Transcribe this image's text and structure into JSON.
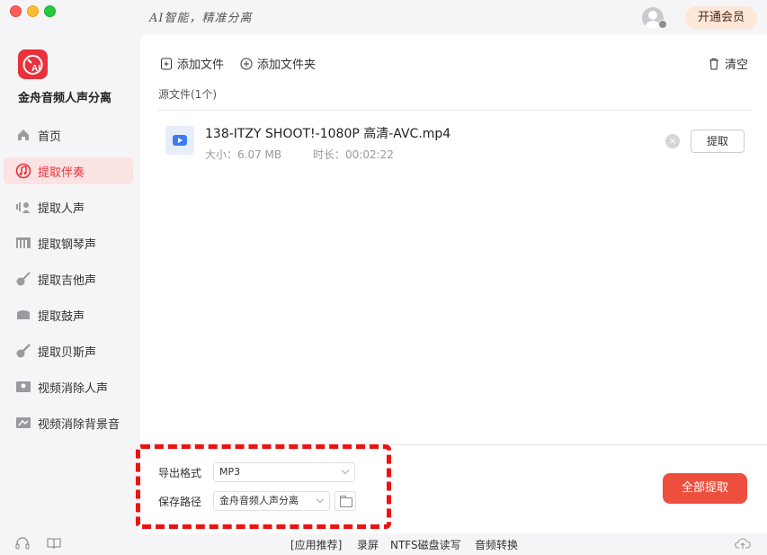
{
  "titlebar": {
    "slogan": "AI智能，精准分离",
    "vip_button": "开通会员"
  },
  "sidebar": {
    "app_name": "金舟音频人声分离",
    "logo_text": "AI",
    "items": [
      {
        "label": "首页",
        "icon": "home-icon"
      },
      {
        "label": "提取伴奏",
        "icon": "accompaniment-icon",
        "active": true
      },
      {
        "label": "提取人声",
        "icon": "voice-icon"
      },
      {
        "label": "提取钢琴声",
        "icon": "piano-icon"
      },
      {
        "label": "提取吉他声",
        "icon": "guitar-icon"
      },
      {
        "label": "提取鼓声",
        "icon": "drum-icon"
      },
      {
        "label": "提取贝斯声",
        "icon": "bass-icon"
      },
      {
        "label": "视频消除人声",
        "icon": "video-remove-voice-icon"
      },
      {
        "label": "视频消除背景音",
        "icon": "video-remove-bg-icon"
      }
    ]
  },
  "toolbar": {
    "add_file": "添加文件",
    "add_folder": "添加文件夹",
    "clear": "清空"
  },
  "source_label": "源文件(1个)",
  "files": [
    {
      "name": "138-ITZY SHOOT!-1080P 高清-AVC.mp4",
      "size": "大小：6.07 MB",
      "duration": "时长：00:02:22",
      "extract_label": "提取",
      "remove_symbol": "×"
    }
  ],
  "settings": {
    "format_label": "导出格式",
    "format_value": "MP3",
    "path_label": "保存路径",
    "path_value": "金舟音频人声分离"
  },
  "extract_all": "全部提取",
  "footer": {
    "links": [
      "[应用推荐]",
      "录屏",
      "NTFS磁盘读写",
      "音频转换"
    ]
  },
  "colors": {
    "accent": "#e8323c",
    "extract_all_bg": "#ee4e3e",
    "vip_bg": "#fde7d8",
    "annotation": "#ee1111"
  }
}
